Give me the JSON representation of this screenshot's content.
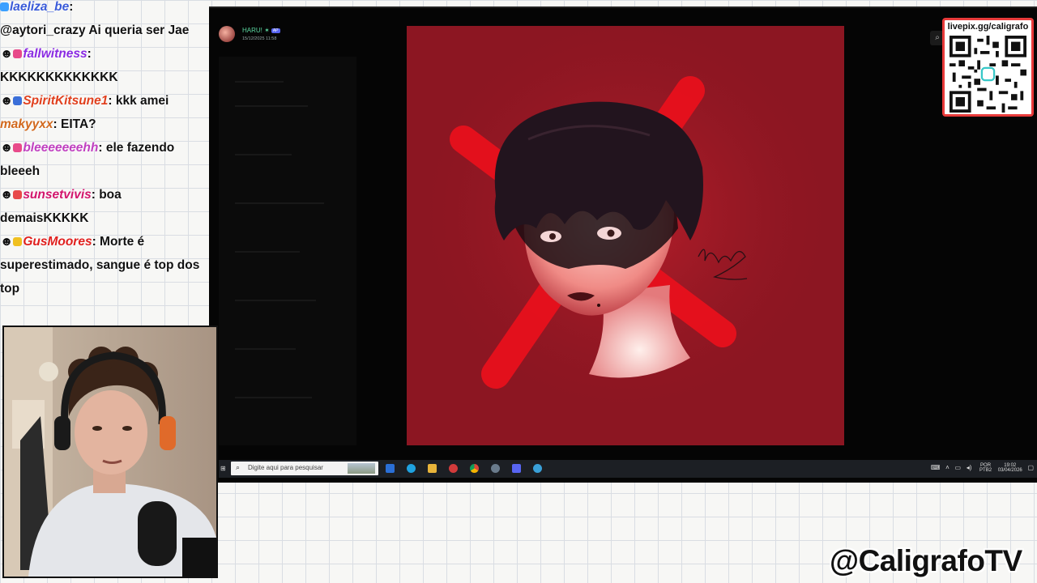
{
  "chat": {
    "messages": [
      {
        "user": "laeliza_be",
        "text": "",
        "badge_color": "#3ba0ff",
        "name_color": "#3a5bd9"
      },
      {
        "user": "",
        "text": "@aytori_crazy Ai queria ser Jae",
        "badge_color": "",
        "name_color": ""
      },
      {
        "user": "fallwitness",
        "text": "KKKKKKKKKKKKK",
        "badge_color": "#e84a8a",
        "name_color": "#8a2be2"
      },
      {
        "user": "SpiritKitsune1",
        "text": "kkk amei",
        "badge_color": "#3b6fd9",
        "name_color": "#e0401e"
      },
      {
        "user": "makyyxx",
        "text": "EITA?",
        "badge_color": "",
        "name_color": "#d2691e"
      },
      {
        "user": "bleeeeeeehh",
        "text": "ele fazendo bleeeh",
        "badge_color": "#e84a8a",
        "name_color": "#c040c0"
      },
      {
        "user": "sunsetvivis",
        "text": "boa demaisKKKKK",
        "badge_color": "#e84a4a",
        "name_color": "#d2156c"
      },
      {
        "user": "GusMoores",
        "text": "Morte é superestimado, sangue é top dos top",
        "badge_color": "#f0c020",
        "name_color": "#e0201e"
      }
    ]
  },
  "post": {
    "author": "HARU! ✶",
    "badge": "AP",
    "date": "15/12/2025 11:58"
  },
  "artwork": {
    "signature": "Haru",
    "background_color": "#8c1622",
    "cross_color": "#e8101c"
  },
  "taskbar": {
    "search_placeholder": "Digite aqui para pesquisar",
    "lang_top": "POR",
    "lang_bottom": "PTB2",
    "time": "19:02",
    "date": "03/04/2026"
  },
  "qr": {
    "label": "livepix.gg/caligrafo",
    "accent": "#e83a3a"
  },
  "channel": {
    "handle": "@CaligrafoTV"
  }
}
